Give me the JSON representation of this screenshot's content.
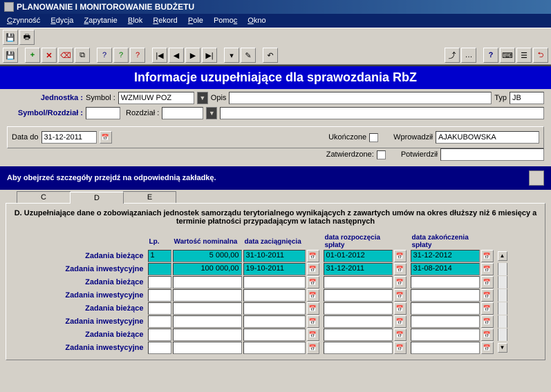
{
  "title": "PLANOWANIE I MONITOROWANIE BUDŻETU",
  "menu": {
    "czynnosc": "Czynność",
    "edycja": "Edycja",
    "zapytanie": "Zapytanie",
    "blok": "Blok",
    "rekord": "Rekord",
    "pole": "Pole",
    "pomoc": "Pomoc",
    "okno": "Okno"
  },
  "header_band": "Informacje uzupełniające dla sprawozdania RbZ",
  "form": {
    "jednostka_label": "Jednostka :",
    "symbol_label": "Symbol :",
    "symbol_value": "WZMIUW POZ",
    "opis_label": "Opis",
    "opis_value": "",
    "typ_label": "Typ",
    "typ_value": "JB",
    "symbol_rozdzial_label": "Symbol/Rozdział :",
    "symbol_rozdzial_value": "",
    "rozdzial_label": "Rozdział :",
    "rozdzial_value": "",
    "rozdzial_desc": "",
    "data_do_label": "Data do",
    "data_do_value": "31-12-2011",
    "ukonczone_label": "Ukończone",
    "zatwierdzone_label": "Zatwierdzone:",
    "wprowadzil_label": "Wprowadził",
    "wprowadzil_value": "AJAKUBOWSKA",
    "potwierdzil_label": "Potwierdził",
    "potwierdzil_value": ""
  },
  "info_band": "Aby obejrzeć szczegóły przejdź na odpowiednią zakładkę.",
  "tabs": {
    "c": "C",
    "d": "D",
    "e": "E"
  },
  "panel_title": "D. Uzupełniające dane o zobowiązaniach jednostek samorządu terytorialnego wynikających z zawartych umów na okres dłuższy niż 6 miesięcy a terminie płatności przypadającym w latach następnych",
  "grid": {
    "headers": {
      "lp": "Lp.",
      "wartosc": "Wartość nominalna",
      "data_zac": "data zaciągnięcia",
      "data_rozp": "data rozpoczęcia spłaty",
      "data_zak": "data zakończenia spłaty"
    },
    "row_labels": {
      "biezace": "Zadania bieżące",
      "inwestycyjne": "Zadania inwestycyjne"
    },
    "rows": [
      {
        "label_key": "biezace",
        "lp": "1",
        "wartosc": "5 000,00",
        "data_zac": "31-10-2011",
        "data_rozp": "01-01-2012",
        "data_zak": "31-12-2012",
        "teal": true
      },
      {
        "label_key": "inwestycyjne",
        "lp": "",
        "wartosc": "100 000,00",
        "data_zac": "19-10-2011",
        "data_rozp": "31-12-2011",
        "data_zak": "31-08-2014",
        "teal": true
      },
      {
        "label_key": "biezace",
        "lp": "",
        "wartosc": "",
        "data_zac": "",
        "data_rozp": "",
        "data_zak": "",
        "teal": false
      },
      {
        "label_key": "inwestycyjne",
        "lp": "",
        "wartosc": "",
        "data_zac": "",
        "data_rozp": "",
        "data_zak": "",
        "teal": false
      },
      {
        "label_key": "biezace",
        "lp": "",
        "wartosc": "",
        "data_zac": "",
        "data_rozp": "",
        "data_zak": "",
        "teal": false
      },
      {
        "label_key": "inwestycyjne",
        "lp": "",
        "wartosc": "",
        "data_zac": "",
        "data_rozp": "",
        "data_zak": "",
        "teal": false
      },
      {
        "label_key": "biezace",
        "lp": "",
        "wartosc": "",
        "data_zac": "",
        "data_rozp": "",
        "data_zak": "",
        "teal": false
      },
      {
        "label_key": "inwestycyjne",
        "lp": "",
        "wartosc": "",
        "data_zac": "",
        "data_rozp": "",
        "data_zak": "",
        "teal": false
      }
    ]
  }
}
